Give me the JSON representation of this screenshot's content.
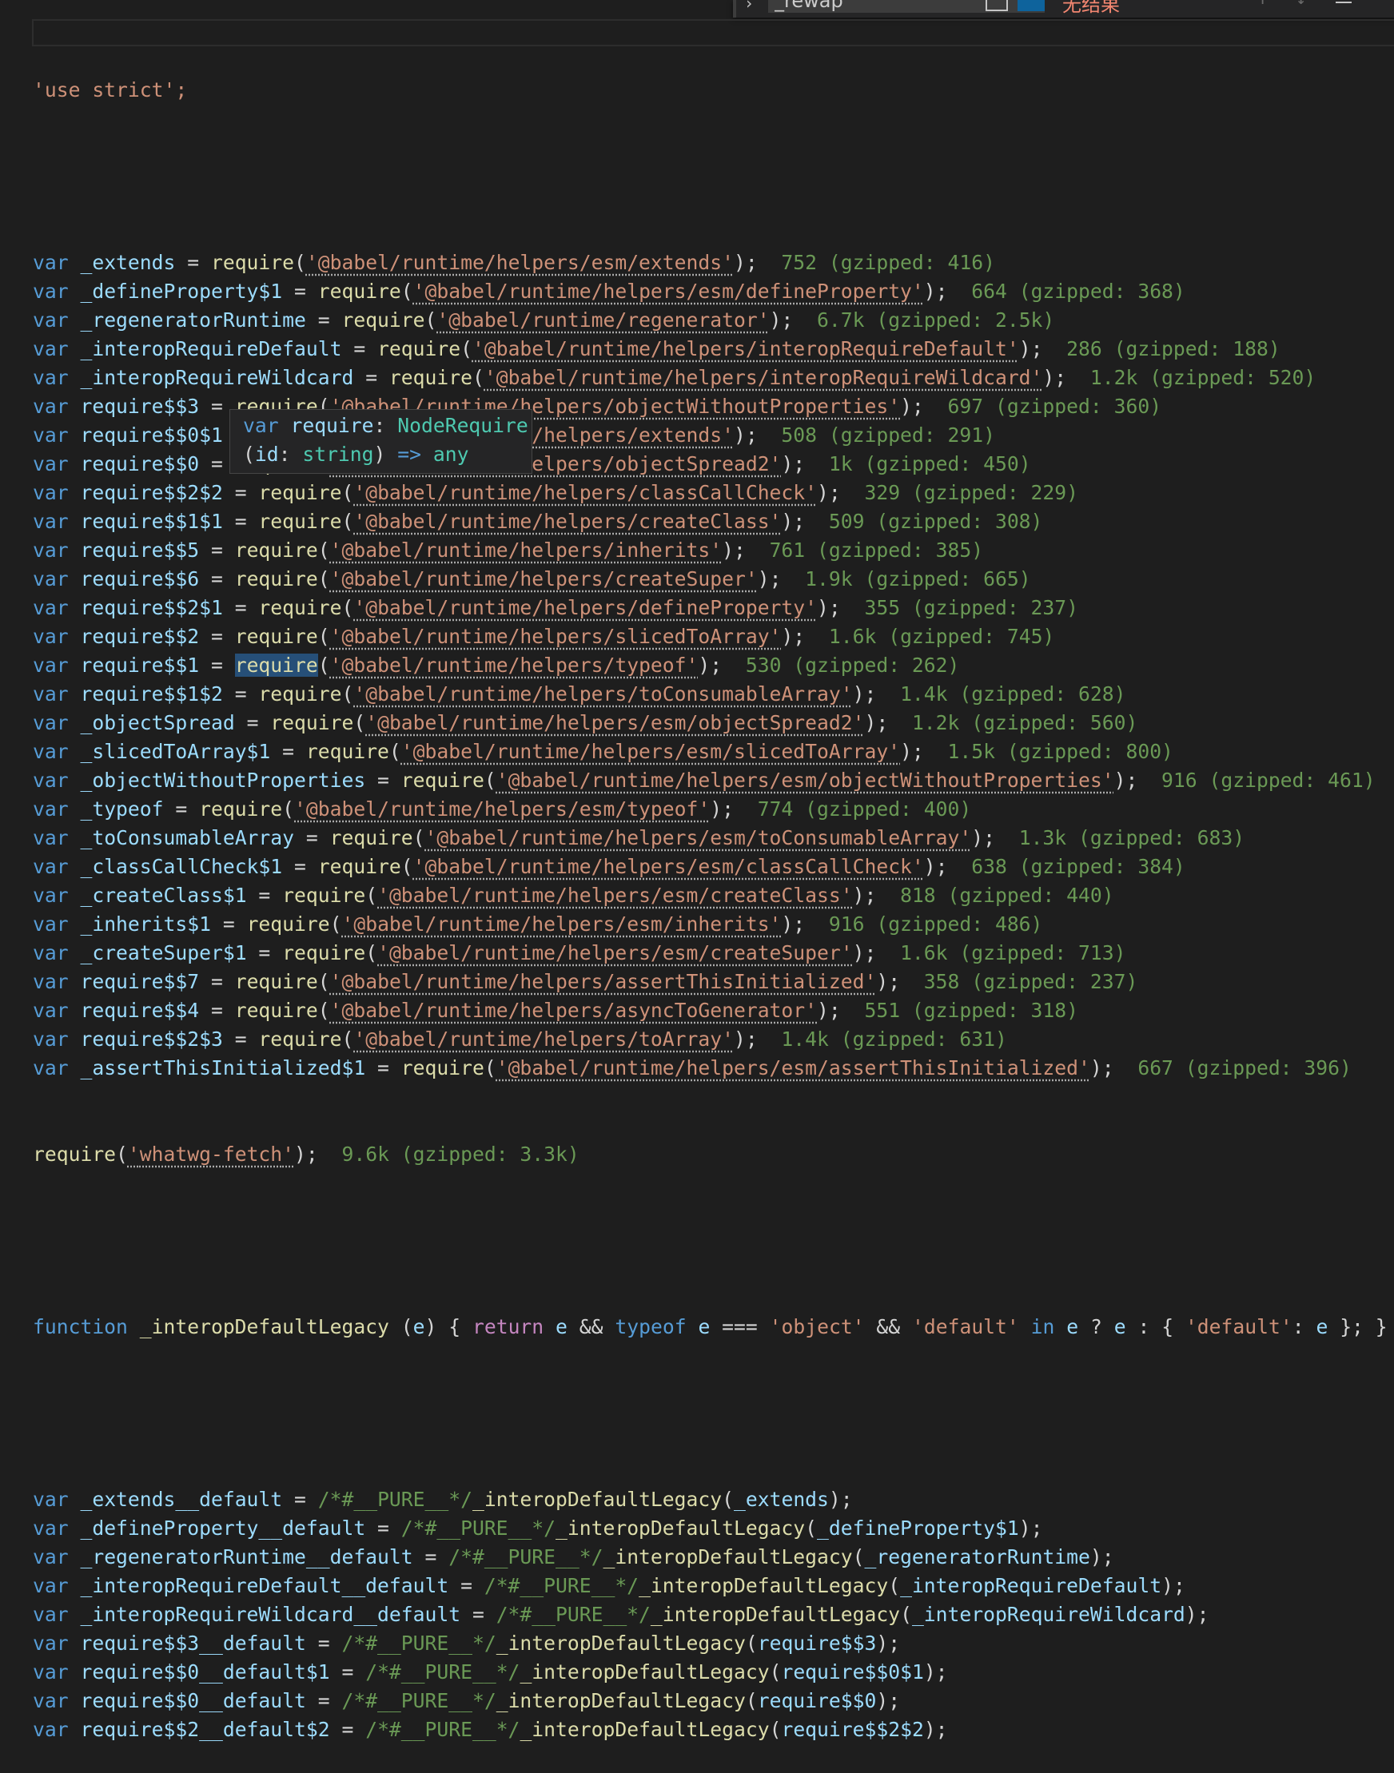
{
  "find_widget": {
    "input_value": "_rewap",
    "result_text": "无结果"
  },
  "hover_tooltip": {
    "line1": "var require: NodeRequire",
    "line2": "(id: string) => any"
  },
  "code": {
    "use_strict": "'use strict';",
    "requires": [
      {
        "name": "_extends",
        "module": "@babel/runtime/helpers/esm/extends",
        "size": "752 (gzipped: 416)"
      },
      {
        "name": "_defineProperty$1",
        "module": "@babel/runtime/helpers/esm/defineProperty",
        "size": "664 (gzipped: 368)"
      },
      {
        "name": "_regeneratorRuntime",
        "module": "@babel/runtime/regenerator",
        "size": "6.7k (gzipped: 2.5k)"
      },
      {
        "name": "_interopRequireDefault",
        "module": "@babel/runtime/helpers/interopRequireDefault",
        "size": "286 (gzipped: 188)"
      },
      {
        "name": "_interopRequireWildcard",
        "module": "@babel/runtime/helpers/interopRequireWildcard",
        "size": "1.2k (gzipped: 520)"
      },
      {
        "name": "require$$3",
        "module": "@babel/runtime/helpers/objectWithoutProperties",
        "size": "697 (gzipped: 360)"
      },
      {
        "name": "require$$0$1",
        "module": "@babel/runtime/helpers/extends",
        "size": "508 (gzipped: 291)"
      },
      {
        "name": "require$$0",
        "module": "@babel/runtime/helpers/objectSpread2",
        "size": "1k (gzipped: 450)"
      },
      {
        "name": "require$$2$2",
        "module": "@babel/runtime/helpers/classCallCheck",
        "size": "329 (gzipped: 229)"
      },
      {
        "name": "require$$1$1",
        "module": "@babel/runtime/helpers/createClass",
        "size": "509 (gzipped: 308)"
      },
      {
        "name": "require$$5",
        "module": "@babel/runtime/helpers/inherits",
        "size": "761 (gzipped: 385)"
      },
      {
        "name": "require$$6",
        "module": "@babel/runtime/helpers/createSuper",
        "size": "1.9k (gzipped: 665)"
      },
      {
        "name": "require$$2$1",
        "module": "@babel/runtime/helpers/defineProperty",
        "size": "355 (gzipped: 237)"
      },
      {
        "name": "require$$2",
        "module": "@babel/runtime/helpers/slicedToArray",
        "size": "1.6k (gzipped: 745)"
      },
      {
        "name": "require$$1",
        "module": "@babel/runtime/helpers/typeof",
        "size": "530 (gzipped: 262)"
      },
      {
        "name": "require$$1$2",
        "module": "@babel/runtime/helpers/toConsumableArray",
        "size": "1.4k (gzipped: 628)"
      },
      {
        "name": "_objectSpread",
        "module": "@babel/runtime/helpers/esm/objectSpread2",
        "size": "1.2k (gzipped: 560)"
      },
      {
        "name": "_slicedToArray$1",
        "module": "@babel/runtime/helpers/esm/slicedToArray",
        "size": "1.5k (gzipped: 800)"
      },
      {
        "name": "_objectWithoutProperties",
        "module": "@babel/runtime/helpers/esm/objectWithoutProperties",
        "size": "916 (gzipped: 461)"
      },
      {
        "name": "_typeof",
        "module": "@babel/runtime/helpers/esm/typeof",
        "size": "774 (gzipped: 400)"
      },
      {
        "name": "_toConsumableArray",
        "module": "@babel/runtime/helpers/esm/toConsumableArray",
        "size": "1.3k (gzipped: 683)"
      },
      {
        "name": "_classCallCheck$1",
        "module": "@babel/runtime/helpers/esm/classCallCheck",
        "size": "638 (gzipped: 384)"
      },
      {
        "name": "_createClass$1",
        "module": "@babel/runtime/helpers/esm/createClass",
        "size": "818 (gzipped: 440)"
      },
      {
        "name": "_inherits$1",
        "module": "@babel/runtime/helpers/esm/inherits",
        "size": "916 (gzipped: 486)"
      },
      {
        "name": "_createSuper$1",
        "module": "@babel/runtime/helpers/esm/createSuper",
        "size": "1.6k (gzipped: 713)"
      },
      {
        "name": "require$$7",
        "module": "@babel/runtime/helpers/assertThisInitialized",
        "size": "358 (gzipped: 237)"
      },
      {
        "name": "require$$4",
        "module": "@babel/runtime/helpers/asyncToGenerator",
        "size": "551 (gzipped: 318)"
      },
      {
        "name": "require$$2$3",
        "module": "@babel/runtime/helpers/toArray",
        "size": "1.4k (gzipped: 631)"
      },
      {
        "name": "_assertThisInitialized$1",
        "module": "@babel/runtime/helpers/esm/assertThisInitialized",
        "size": "667 (gzipped: 396)"
      }
    ],
    "bare_require": {
      "module": "whatwg-fetch",
      "size": "9.6k (gzipped: 3.3k)"
    },
    "interop_fn": "function _interopDefaultLegacy (e) { return e && typeof e === 'object' && 'default' in e ? e : { 'default': e }; }",
    "defaults": [
      {
        "name": "_extends__default",
        "arg": "_extends"
      },
      {
        "name": "_defineProperty__default",
        "arg": "_defineProperty$1"
      },
      {
        "name": "_regeneratorRuntime__default",
        "arg": "_regeneratorRuntime"
      },
      {
        "name": "_interopRequireDefault__default",
        "arg": "_interopRequireDefault"
      },
      {
        "name": "_interopRequireWildcard__default",
        "arg": "_interopRequireWildcard"
      },
      {
        "name": "require$$3__default",
        "arg": "require$$3"
      },
      {
        "name": "require$$0__default$1",
        "arg": "require$$0$1"
      },
      {
        "name": "require$$0__default",
        "arg": "require$$0"
      },
      {
        "name": "require$$2__default$2",
        "arg": "require$$2$2"
      }
    ]
  }
}
